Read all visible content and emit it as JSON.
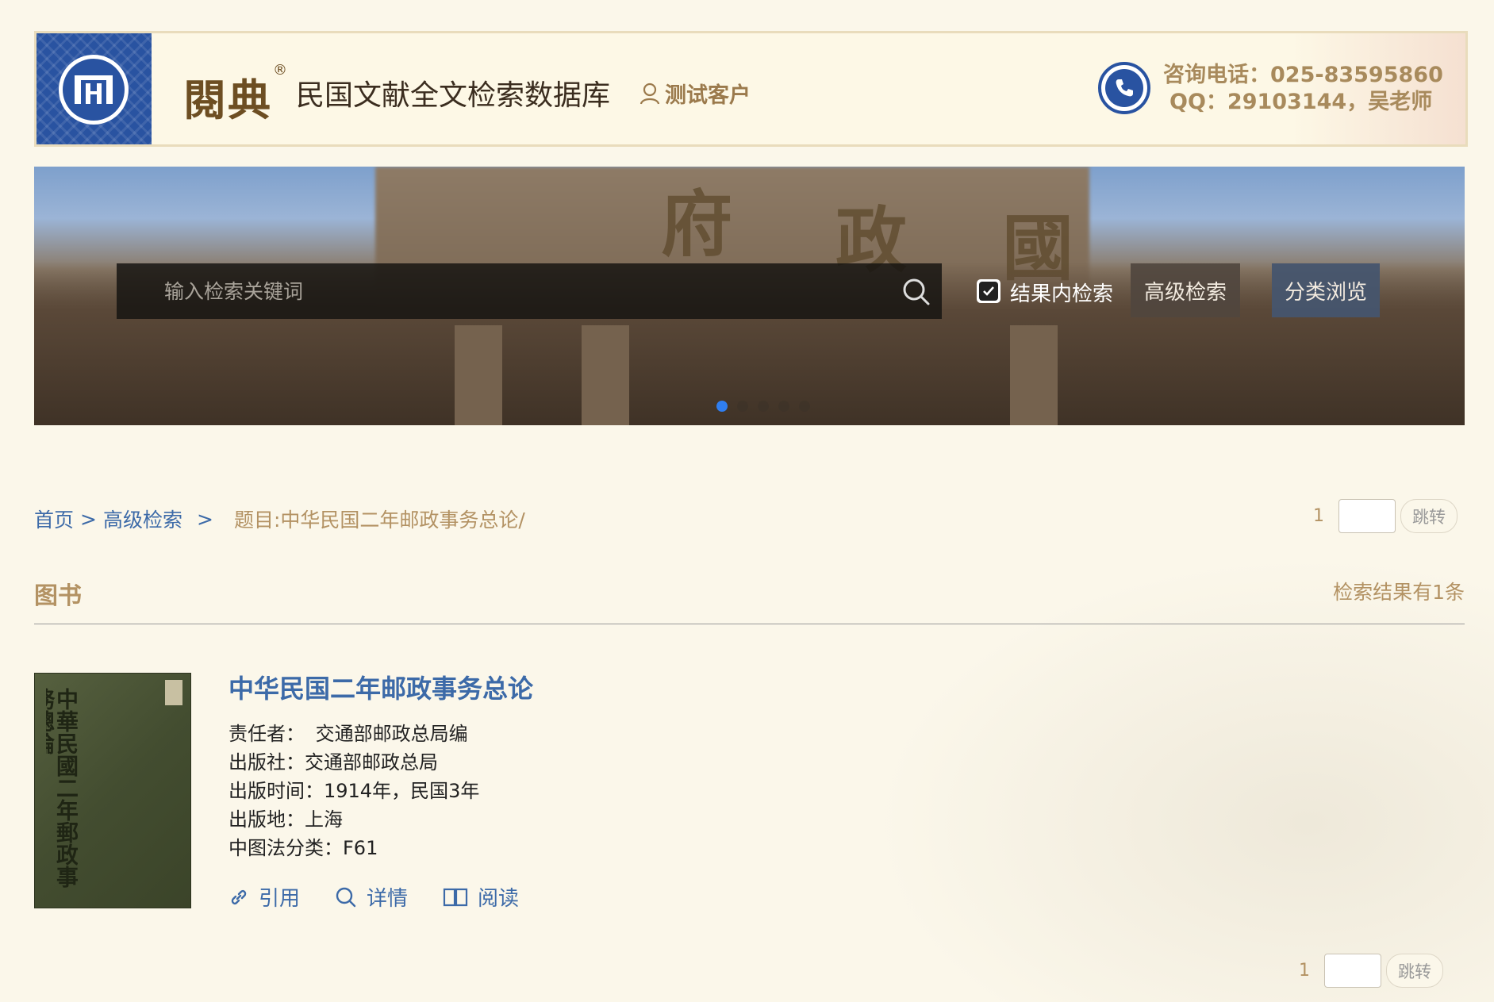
{
  "header": {
    "brand": "閱典",
    "brand_mark": "®",
    "db_title": "民国文献全文检索数据库",
    "user_name": "测试客户",
    "phone_line": "咨询电话：025-83595860",
    "qq_line": "QQ：29103144，吴老师",
    "logo_color": "#2953a1"
  },
  "search": {
    "placeholder": "输入检索关键词",
    "value": "",
    "within_results_label": "结果内检索",
    "within_results_checked": true,
    "advanced_label": "高级检索",
    "browse_label": "分类浏览"
  },
  "carousel": {
    "dots": 5,
    "active": 0
  },
  "breadcrumb": {
    "home": "首页",
    "sep": ">",
    "advanced": "高级检索",
    "sep2": ">",
    "current": "题目:中华民国二年邮政事务总论/"
  },
  "pager_top": {
    "page": "1",
    "go_label": "跳转"
  },
  "pager_bottom": {
    "page": "1",
    "go_label": "跳转"
  },
  "section": {
    "title": "图书",
    "result_count": "检索结果有1条"
  },
  "result": {
    "title": "中华民国二年邮政事务总论",
    "cover_text": "中華民國二年郵政事務總論",
    "meta": [
      {
        "label": "责任者：",
        "value": " 交通部邮政总局编"
      },
      {
        "label": "出版社：",
        "value": "交通部邮政总局"
      },
      {
        "label": "出版时间：",
        "value": "1914年，民国3年"
      },
      {
        "label": "出版地：",
        "value": "上海"
      },
      {
        "label": "中图法分类：",
        "value": "F61"
      }
    ],
    "actions": {
      "cite": "引用",
      "detail": "详情",
      "read": "阅读"
    }
  }
}
